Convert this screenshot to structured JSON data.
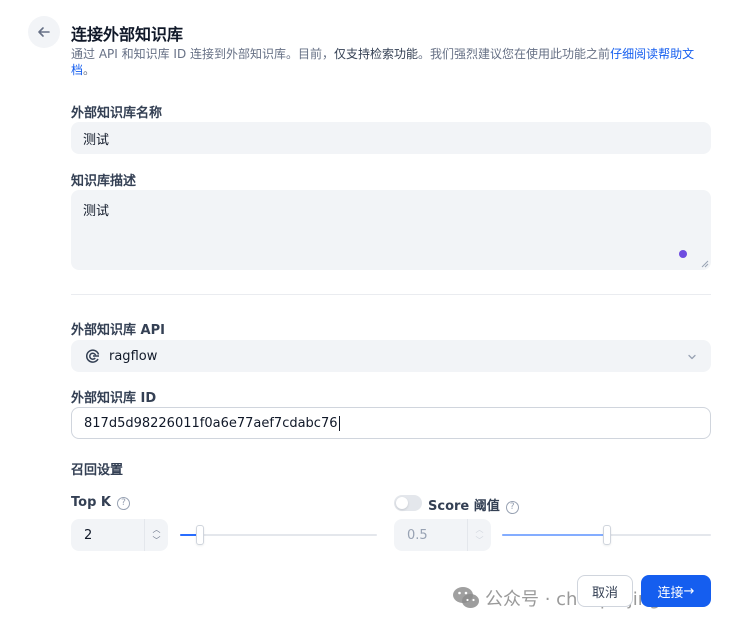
{
  "header": {
    "title": "连接外部知识库",
    "description_prefix": "通过 API 和知识库 ID 连接到外部知识库。目前，",
    "description_strong": "仅支持检索功能",
    "description_middle": "。我们强烈建议您在使用此功能之前",
    "description_link": "仔细阅读帮助文档",
    "description_suffix": "。"
  },
  "form": {
    "name_label": "外部知识库名称",
    "name_value": "测试",
    "desc_label": "知识库描述",
    "desc_value": "测试",
    "api_label": "外部知识库 API",
    "api_value": "ragflow",
    "id_label": "外部知识库 ID",
    "id_value": "817d5d98226011f0a6e77aef7cdabc76"
  },
  "retrieval": {
    "section_label": "召回设置",
    "topk_label": "Top K",
    "topk_value": "2",
    "topk_fraction": 0.1,
    "score_label": "Score 阈值",
    "score_value": "0.5",
    "score_fraction": 0.5,
    "score_enabled": false,
    "help_glyph": "?"
  },
  "actions": {
    "cancel_label": "取消",
    "connect_label": "连接",
    "connect_arrow": "→"
  },
  "watermark": {
    "text": "公众号 · chanpinjingtan"
  },
  "icons": {
    "back": "arrow-left-icon",
    "api": "ragflow-logo-icon",
    "chevron": "chevron-down-icon",
    "help": "question-circle-icon",
    "wechat": "wechat-icon"
  },
  "colors": {
    "primary": "#155eef",
    "input_bg": "#f2f4f7",
    "accent_dot": "#6e4ce0"
  }
}
